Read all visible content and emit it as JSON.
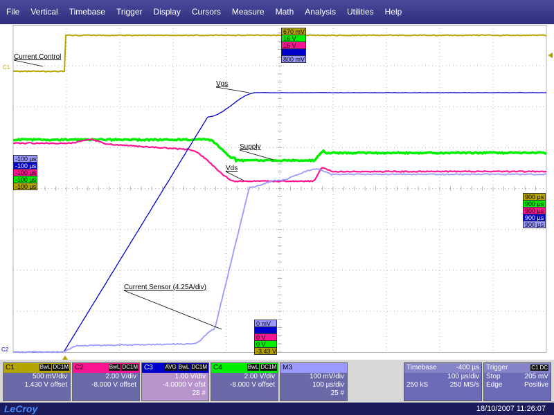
{
  "menu": [
    "File",
    "Vertical",
    "Timebase",
    "Trigger",
    "Display",
    "Cursors",
    "Measure",
    "Math",
    "Analysis",
    "Utilities",
    "Help"
  ],
  "colors": {
    "c1": "#b5a400",
    "c2": "#ff1493",
    "c3": "#0000cc",
    "c4": "#00ee00",
    "math": "#9999ff",
    "grid": "#b0b0b0"
  },
  "annotations": {
    "current_control": "Current Control",
    "vgs": "Vgs",
    "supply": "Supply",
    "vds": "Vds",
    "current_sensor": "Current Sensor (4.25A/div)"
  },
  "channel_markers": {
    "c1": "C1",
    "bottom": "C2"
  },
  "tags_top": [
    "670 mV",
    "16 V",
    "16 V",
    "",
    "800 mV"
  ],
  "tags_left": [
    "-100 µs",
    "-100 µs",
    "-100 µs",
    "-100 µs",
    "-100 µs"
  ],
  "tags_right": [
    "900 µs",
    "900 µs",
    "900 µs",
    "900 µs",
    "900 µs"
  ],
  "tags_bottom": [
    "0 mV",
    "",
    "0 V",
    "0 V",
    "-3.43 V"
  ],
  "channels": [
    {
      "name": "C1",
      "badges": [
        "BwL",
        "DC1M"
      ],
      "scale": "500 mV/div",
      "offset": "1.430 V offset",
      "extra": ""
    },
    {
      "name": "C2",
      "badges": [
        "BwL",
        "DC1M"
      ],
      "scale": "2.00 V/div",
      "offset": "-8.000 V offset",
      "extra": ""
    },
    {
      "name": "C3",
      "badges": [
        "AVG",
        "BwL",
        "DC1M"
      ],
      "scale": "1.00 V/div",
      "offset": "-4.0000 V ofst",
      "extra": "28 #"
    },
    {
      "name": "C4",
      "badges": [
        "BwL",
        "DC1M"
      ],
      "scale": "2.00 V/div",
      "offset": "-8.000 V offset",
      "extra": ""
    },
    {
      "name": "M3",
      "badges": [],
      "scale": "100 mV/div",
      "offset": "100 µs/div",
      "extra": "25 #"
    }
  ],
  "timebase": {
    "label": "Timebase",
    "delay": "-400 µs",
    "per_div": "100 µs/div",
    "samples": "250 kS",
    "rate": "250 MS/s"
  },
  "trigger": {
    "label": "Trigger",
    "channel": "C1",
    "coupling": "DC",
    "mode": "Stop",
    "level": "205 mV",
    "type": "Edge",
    "slope": "Positive"
  },
  "footer": {
    "logo": "LeCroy",
    "timestamp": "18/10/2007 11:26:07"
  }
}
